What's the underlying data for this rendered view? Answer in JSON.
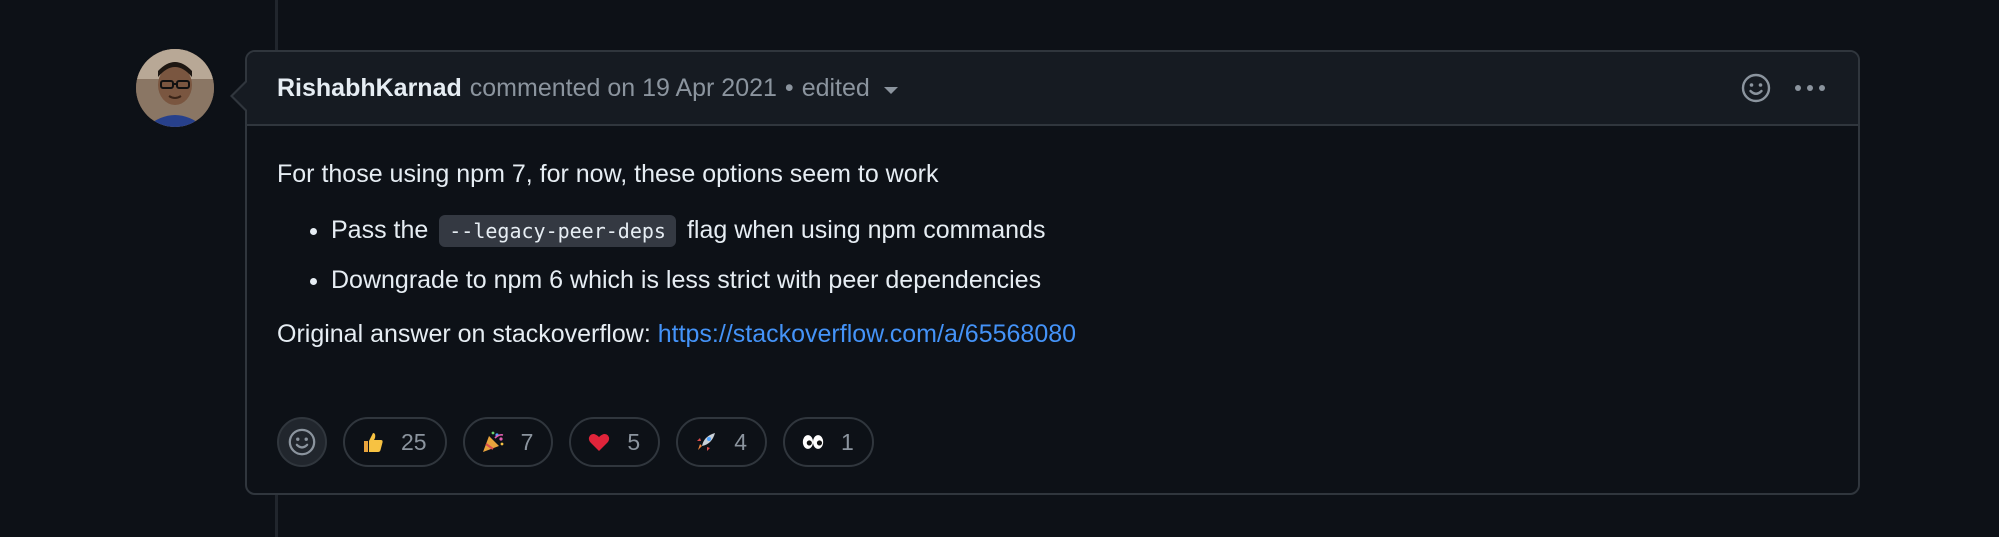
{
  "comment": {
    "author": "RishabhKarnad",
    "meta": "commented on 19 Apr 2021",
    "separator": "•",
    "edited_label": "edited",
    "intro": "For those using npm 7, for now, these options seem to work",
    "options": [
      {
        "before": "Pass the",
        "code": "--legacy-peer-deps",
        "after": "flag when using npm commands"
      },
      {
        "text": "Downgrade to npm 6 which is less strict with peer dependencies"
      }
    ],
    "original_label": "Original answer on stackoverflow:",
    "original_link": "https://stackoverflow.com/a/65568080"
  },
  "header_icons": [
    "smiley-icon",
    "kebab-icon"
  ],
  "reactions": [
    {
      "icon": "thumbs-up-icon",
      "count": "25"
    },
    {
      "icon": "party-popper-icon",
      "count": "7"
    },
    {
      "icon": "heart-icon",
      "count": "5"
    },
    {
      "icon": "rocket-icon",
      "count": "4"
    },
    {
      "icon": "eyes-icon",
      "count": "1"
    }
  ],
  "colors": {
    "background": "#0d1117",
    "header_bg": "#161b22",
    "border": "#30363d",
    "text": "#e6edf3",
    "muted": "#8b949e",
    "link": "#4493f8"
  }
}
